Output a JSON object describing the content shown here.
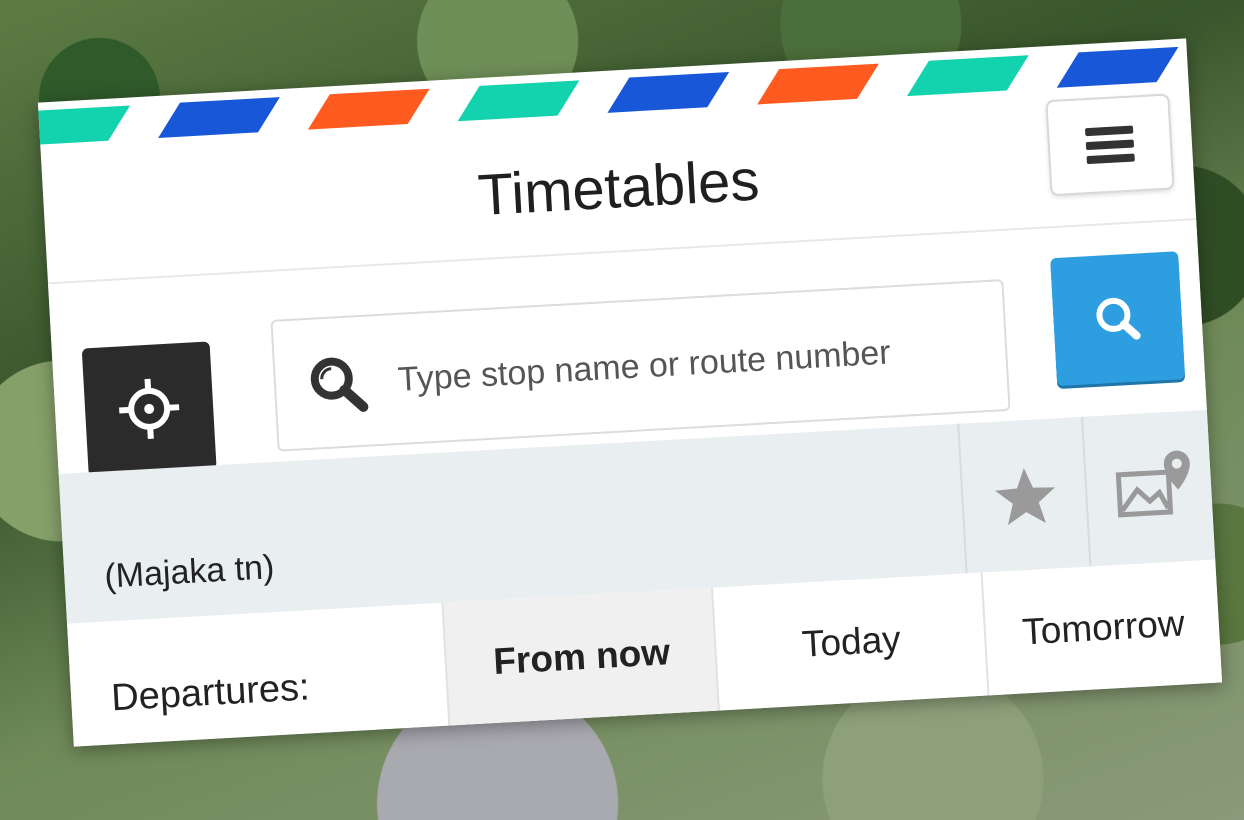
{
  "header": {
    "title": "Timetables"
  },
  "colors": {
    "stripe_teal": "#13d3ae",
    "stripe_blue": "#1858d8",
    "stripe_orange": "#ff5a1f",
    "search_button": "#2d9fe0",
    "locate_button": "#2b2b2b"
  },
  "icons": {
    "menu": "hamburger-icon",
    "locate": "crosshair-icon",
    "search_field": "search-icon",
    "search_button": "search-icon",
    "favourite": "star-icon",
    "map": "map-pin-icon"
  },
  "search": {
    "placeholder": "Type stop name or route number"
  },
  "stop": {
    "name": "(Majaka tn)"
  },
  "departures": {
    "label": "Departures:",
    "tabs": [
      {
        "label": "From now",
        "active": true
      },
      {
        "label": "Today",
        "active": false
      },
      {
        "label": "Tomorrow",
        "active": false
      }
    ]
  }
}
